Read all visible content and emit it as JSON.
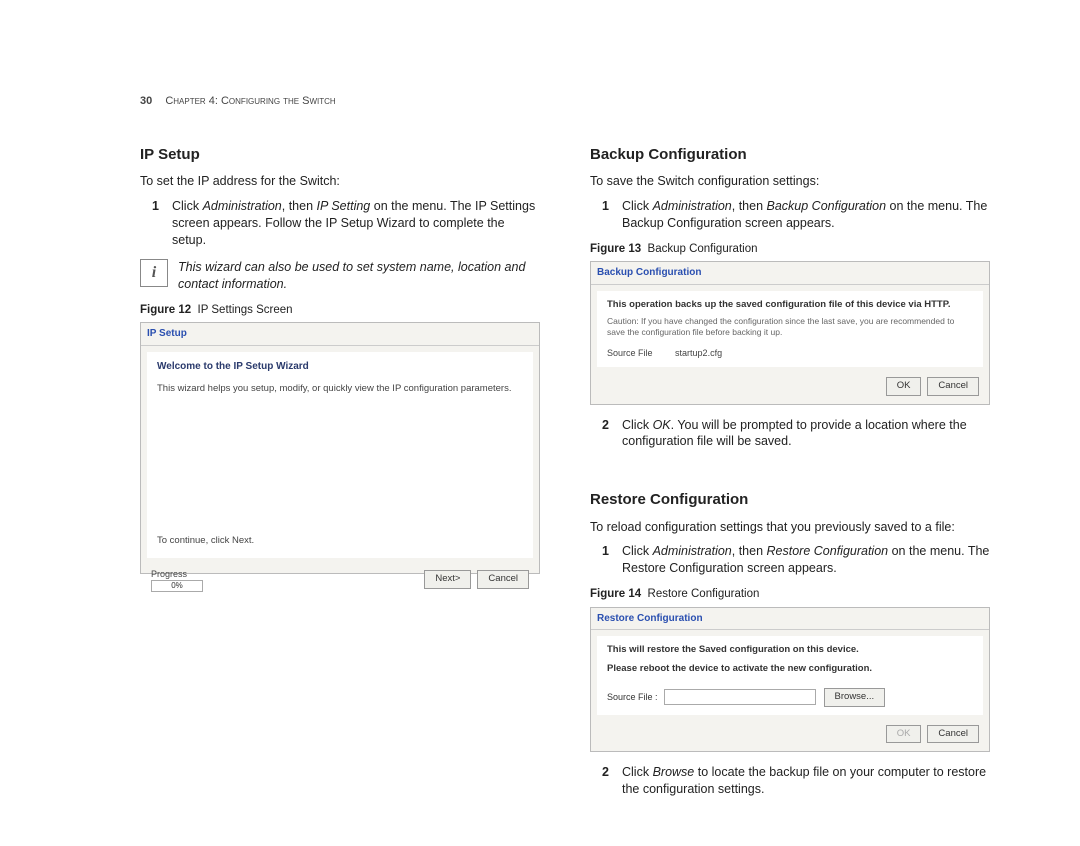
{
  "header": {
    "page_num": "30",
    "chapter": "Chapter 4: Configuring the Switch"
  },
  "left": {
    "h_ip": "IP Setup",
    "ip_intro": "To set the IP address for the Switch:",
    "ip_step1_num": "1",
    "ip_step1_a": "Click ",
    "ip_step1_b": "Administration",
    "ip_step1_c": ", then ",
    "ip_step1_d": "IP Setting",
    "ip_step1_e": " on the menu. The IP Settings screen appears. Follow the IP Setup Wizard to complete the setup.",
    "note": "This wizard can also be used to set system name, location and contact information.",
    "fig12_label": "Figure 12",
    "fig12_caption": "IP Settings Screen",
    "shot_ip_title": "IP Setup",
    "shot_ip_welcome": "Welcome to the IP Setup Wizard",
    "shot_ip_body": "This wizard helps you setup, modify, or quickly view the IP configuration parameters.",
    "shot_ip_continue": "To continue, click Next.",
    "progress_label": "Progress",
    "progress_val": "0%",
    "btn_next": "Next>",
    "btn_cancel": "Cancel"
  },
  "right": {
    "h_backup": "Backup Configuration",
    "backup_intro": "To save the Switch configuration settings:",
    "backup_step1_num": "1",
    "backup_step1_a": "Click ",
    "backup_step1_b": "Administration",
    "backup_step1_c": ", then ",
    "backup_step1_d": "Backup Configuration",
    "backup_step1_e": " on the menu. The Backup Configuration screen appears.",
    "fig13_label": "Figure 13",
    "fig13_caption": "Backup Configuration",
    "shot_bk_title": "Backup Configuration",
    "shot_bk_bold": "This operation backs up the saved configuration file of this device via HTTP.",
    "shot_bk_caution": "Caution: If you have changed the configuration since the last save, you are recommended to save the configuration file before backing it up.",
    "shot_bk_src_label": "Source File",
    "shot_bk_src_file": "startup2.cfg",
    "btn_ok": "OK",
    "btn_cancel2": "Cancel",
    "backup_step2_num": "2",
    "backup_step2_a": "Click ",
    "backup_step2_b": "OK",
    "backup_step2_c": ". You will be prompted to provide a location where the configuration file will be saved.",
    "h_restore": "Restore Configuration",
    "restore_intro": "To reload configuration settings that you previously saved to a file:",
    "restore_step1_num": "1",
    "restore_step1_a": "Click ",
    "restore_step1_b": "Administration",
    "restore_step1_c": ", then ",
    "restore_step1_d": "Restore Configuration",
    "restore_step1_e": " on the menu. The Restore Configuration screen appears.",
    "fig14_label": "Figure 14",
    "fig14_caption": "Restore Configuration",
    "shot_rs_title": "Restore Configuration",
    "shot_rs_line1": "This will restore the Saved configuration on this device.",
    "shot_rs_line2": "Please reboot the device to activate the new configuration.",
    "shot_rs_src": "Source File :",
    "btn_browse": "Browse...",
    "btn_ok_d": "OK",
    "btn_cancel3": "Cancel",
    "restore_step2_num": "2",
    "restore_step2_a": "Click ",
    "restore_step2_b": "Browse",
    "restore_step2_c": " to locate the backup file on your computer to restore the configuration settings."
  }
}
